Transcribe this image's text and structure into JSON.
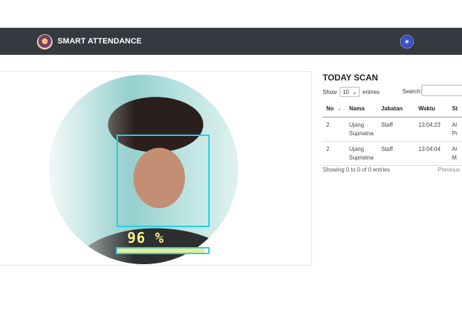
{
  "navbar": {
    "brand": "SMART ATTENDANCE",
    "logo_icon": "school-emblem-logo",
    "avatar_icon": "user-avatar"
  },
  "camera": {
    "confidence_label": "96 %",
    "confidence_value": 96
  },
  "scan": {
    "title": "TODAY SCAN",
    "show_label": "Show",
    "entries_value": "10",
    "entries_label": "entries",
    "search_label": "Search:",
    "search_value": "",
    "columns": [
      "No",
      "Nama",
      "Jabatan",
      "Waktu",
      "St"
    ],
    "rows": [
      {
        "no": "2",
        "nama": "Ujang Supriatna",
        "jabatan": "Staff",
        "waktu": "13:04:23",
        "st": "Al Pr"
      },
      {
        "no": "2",
        "nama": "Ujang Supriatna",
        "jabatan": "Staff",
        "waktu": "13:04:04",
        "st": "Al M"
      }
    ],
    "info": "Showing 0 to 0 of 0 entries",
    "previous_label": "Previous"
  },
  "colors": {
    "navbar_bg": "#343a40",
    "face_box": "#23d0e6",
    "confidence_text": "#f3ef8a",
    "progress_fill": "#f0ea8c"
  }
}
